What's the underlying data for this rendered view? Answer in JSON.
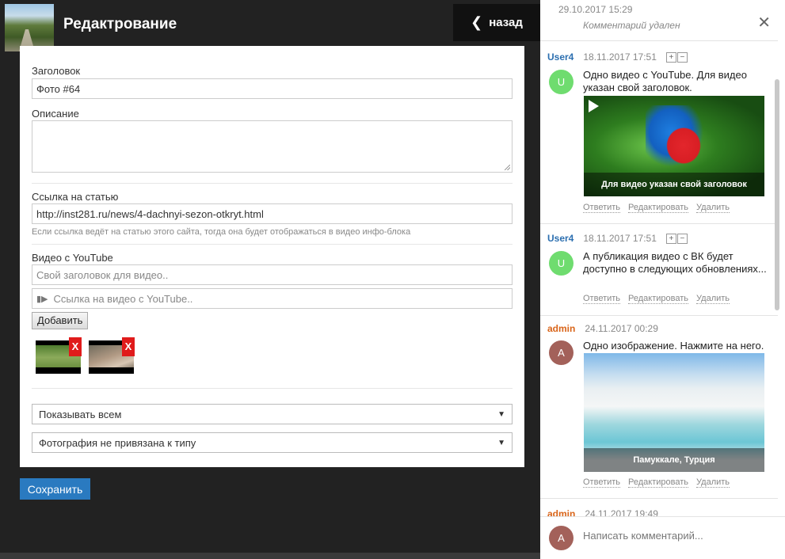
{
  "editor": {
    "title": "Редактрование",
    "back_label": "назад",
    "fields": {
      "title_label": "Заголовок",
      "title_value": "Фото #64",
      "description_label": "Описание",
      "article_label": "Ссылка на статью",
      "article_value": "http://inst281.ru/news/4-dachnyi-sezon-otkryt.html",
      "article_hint": "Если ссылка ведёт на статью этого сайта, тогда она будет отображаться в видео инфо-блока",
      "youtube_label": "Видео с YouTube",
      "youtube_title_placeholder": "Свой заголовок для видео..",
      "youtube_link_placeholder": "Ссылка на видео с YouTube..",
      "add_label": "Добавить",
      "remove_label": "X"
    },
    "visibility_select": "Показывать всем",
    "type_select": "Фотография не привязана к типу",
    "save_label": "Сохранить"
  },
  "comments": {
    "top_date": "29.10.2017 15:29",
    "deleted_text": "Комментарий удален",
    "actions": {
      "reply": "Ответить",
      "edit": "Редактировать",
      "delete": "Удалить"
    },
    "entries": [
      {
        "user": "User4",
        "user_color": "#2c6fb0",
        "time": "18.11.2017 17:51",
        "avatar_letter": "U",
        "avatar_color": "#6fdc6f",
        "text": "Одно видео с YouTube. Для видео указан свой заголовок.",
        "media_caption": "Для видео указан свой заголовок"
      },
      {
        "user": "User4",
        "user_color": "#2c6fb0",
        "time": "18.11.2017 17:51",
        "avatar_letter": "U",
        "avatar_color": "#6fdc6f",
        "text": "А публикация видео с ВК будет доступно в следующих обновлениях..."
      },
      {
        "user": "admin",
        "user_color": "#d9651a",
        "time": "24.11.2017 00:29",
        "avatar_letter": "A",
        "avatar_color": "#a3615a",
        "text": "Одно изображение. Нажмите на него.",
        "media_caption": "Памуккале, Турция"
      },
      {
        "user": "admin",
        "user_color": "#d9651a",
        "time": "24.11.2017 19:49"
      }
    ],
    "input_avatar_letter": "A",
    "input_placeholder": "Написать комментарий..."
  }
}
